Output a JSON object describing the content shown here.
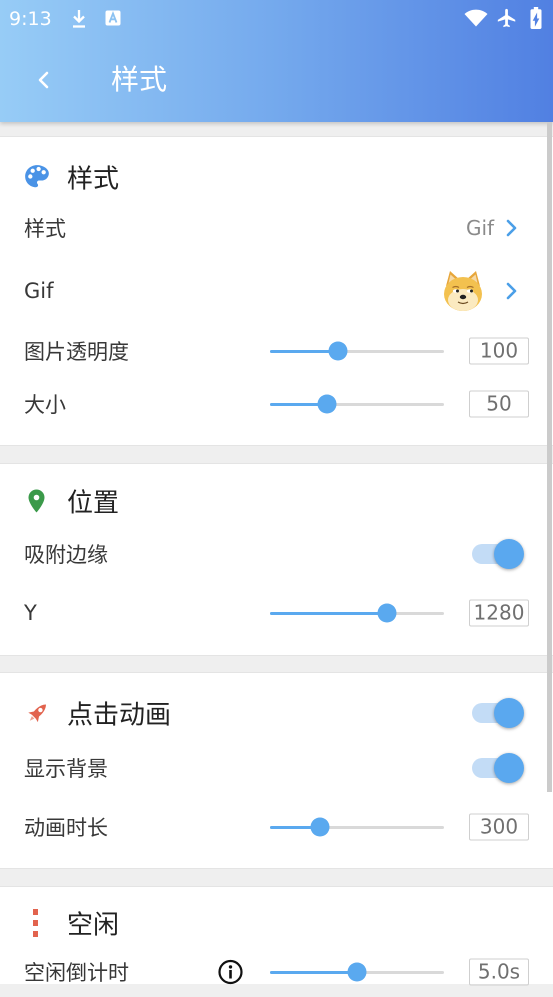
{
  "status_bar": {
    "time": "9:13",
    "icons": {
      "download": "download-icon",
      "app": "a-box-icon",
      "wifi": "wifi-icon",
      "airplane": "airplane-mode-icon",
      "battery": "battery-charging-icon"
    }
  },
  "app_bar": {
    "title": "样式",
    "back_icon": "chevron-left-icon"
  },
  "colors": {
    "header_gradient_start": "#97ccf6",
    "header_gradient_end": "#5180e2",
    "accent": "#5aa9ef",
    "switch_track": "#c3dcf6",
    "chevron": "#4b9fe8",
    "palette_icon": "#4a93e6",
    "pin_icon": "#3b9a4a",
    "rocket_icon": "#e2634e",
    "page_bg": "#efefef"
  },
  "sections": [
    {
      "title": "样式",
      "icon": "palette-icon",
      "rows": [
        {
          "label": "样式",
          "value": "Gif",
          "icon": "chevron-right-icon"
        },
        {
          "label": "Gif",
          "image": "doge-face-image",
          "icon": "chevron-right-icon"
        },
        {
          "label": "图片透明度",
          "value": "100",
          "level": 0.39
        },
        {
          "label": "大小",
          "value": "50",
          "level": 0.33
        }
      ]
    },
    {
      "title": "位置",
      "icon": "location-pin-icon",
      "rows": [
        {
          "label": "吸附边缘",
          "switch_on": true
        },
        {
          "label": "Y",
          "value": "1280",
          "level": 0.67
        }
      ]
    },
    {
      "title": "点击动画",
      "icon": "rocket-icon",
      "switch_on": true,
      "rows": [
        {
          "label": "显示背景",
          "switch_on": true
        },
        {
          "label": "动画时长",
          "value": "300",
          "level": 0.29
        }
      ]
    },
    {
      "title": "空闲",
      "icon": "vertical-dots-icon",
      "rows": [
        {
          "label": "空闲倒计时",
          "info_icon": "info-icon",
          "value": "5.0s",
          "level": 0.5
        }
      ]
    }
  ]
}
